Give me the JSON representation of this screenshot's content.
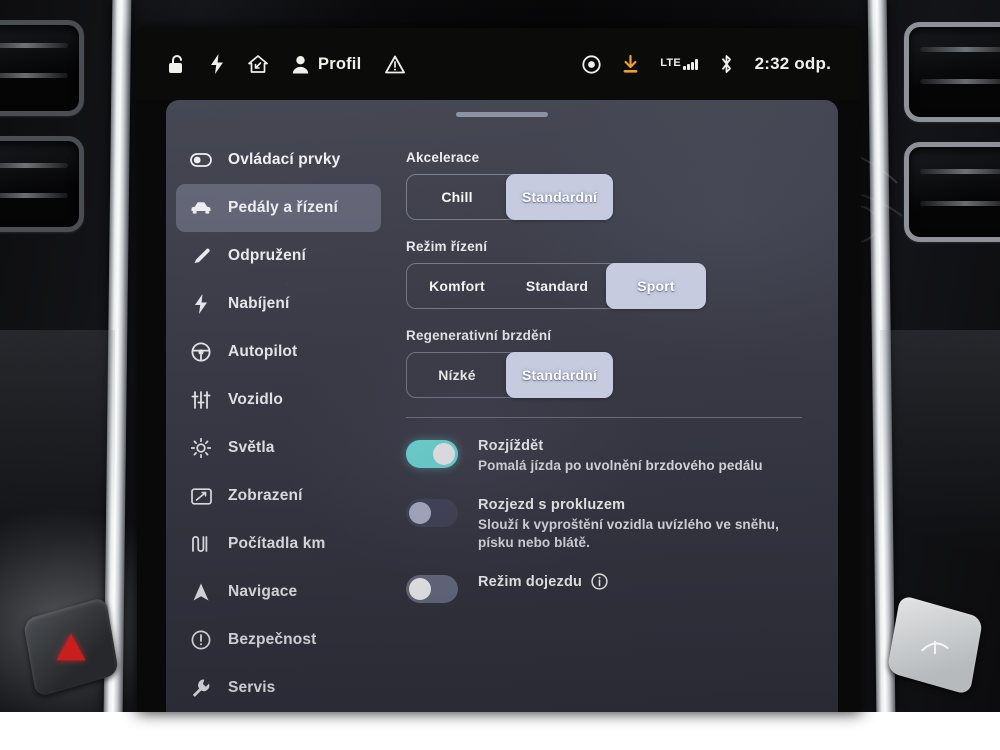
{
  "statusbar": {
    "left_icons": [
      "unlocked-padlock-icon",
      "bolt-icon",
      "home-arrow-icon"
    ],
    "profile_label": "Profil",
    "warning_icon": "warning-triangle-icon",
    "right_icons": [
      "circle-target-icon",
      "download-icon",
      "bluetooth-icon"
    ],
    "network_label": "LTE",
    "signal_bars": 4,
    "time": "2:32 odp."
  },
  "sidebar": {
    "items": [
      {
        "label": "Ovládací prvky",
        "icon": "toggle-icon",
        "active": false
      },
      {
        "label": "Pedály a řízení",
        "icon": "car-icon",
        "active": true
      },
      {
        "label": "Odpružení",
        "icon": "suspension-icon",
        "active": false
      },
      {
        "label": "Nabíjení",
        "icon": "bolt-icon",
        "active": false
      },
      {
        "label": "Autopilot",
        "icon": "steering-wheel-icon",
        "active": false
      },
      {
        "label": "Vozidlo",
        "icon": "sliders-icon",
        "active": false
      },
      {
        "label": "Světla",
        "icon": "sun-icon",
        "active": false
      },
      {
        "label": "Zobrazení",
        "icon": "display-icon",
        "active": false
      },
      {
        "label": "Počítadla km",
        "icon": "odometer-icon",
        "active": false
      },
      {
        "label": "Navigace",
        "icon": "navigation-arrow-icon",
        "active": false
      },
      {
        "label": "Bezpečnost",
        "icon": "alert-circle-icon",
        "active": false
      },
      {
        "label": "Servis",
        "icon": "wrench-icon",
        "active": false
      }
    ]
  },
  "content": {
    "groups": [
      {
        "title": "Akcelerace",
        "options": [
          {
            "label": "Chill",
            "selected": false
          },
          {
            "label": "Standardní",
            "selected": true
          }
        ]
      },
      {
        "title": "Režim řízení",
        "options": [
          {
            "label": "Komfort",
            "selected": false
          },
          {
            "label": "Standard",
            "selected": false
          },
          {
            "label": "Sport",
            "selected": true
          }
        ]
      },
      {
        "title": "Regenerativní brzdění",
        "options": [
          {
            "label": "Nízké",
            "selected": false
          },
          {
            "label": "Standardní",
            "selected": true
          }
        ]
      }
    ],
    "toggles": [
      {
        "label": "Rozjíždět",
        "description": "Pomalá jízda po uvolnění brzdového pedálu",
        "state": "on",
        "info": false
      },
      {
        "label": "Rozjezd s prokluzem",
        "description": "Slouží k vyproštění vozidla uvízlého ve sněhu, písku nebo blátě.",
        "state": "off",
        "info": false
      },
      {
        "label": "Režim dojezdu",
        "description": "",
        "state": "off",
        "info": true
      }
    ]
  },
  "colors": {
    "panel_bg": "#3a3b48",
    "selected_segment": "#c6cbdf",
    "toggle_on": "#6fe8e0",
    "sidebar_active": "#969cb2",
    "status_text": "#f2f0ea",
    "download_accent": "#f0a022",
    "hazard_red": "#c81e1e"
  }
}
